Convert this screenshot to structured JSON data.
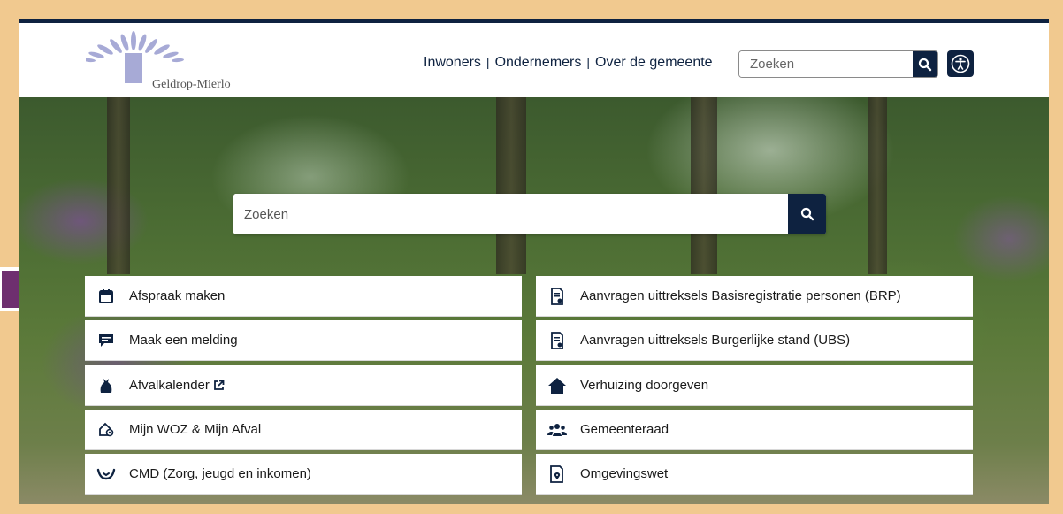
{
  "header": {
    "logo_text": "Geldrop-Mierlo",
    "nav": [
      "Inwoners",
      "Ondernemers",
      "Over de gemeente"
    ],
    "search_placeholder": "Zoeken"
  },
  "hero": {
    "search_placeholder": "Zoeken"
  },
  "tiles_left": [
    {
      "label": "Afspraak maken",
      "icon": "calendar-icon"
    },
    {
      "label": "Maak een melding",
      "icon": "chat-icon"
    },
    {
      "label": "Afvalkalender",
      "icon": "trash-bag-icon"
    },
    {
      "label": "Mijn WOZ & Mijn Afval",
      "icon": "house-pin-icon"
    },
    {
      "label": "CMD (Zorg, jeugd en inkomen)",
      "icon": "care-hands-icon"
    }
  ],
  "tiles_right": [
    {
      "label": "Aanvragen uittreksels Basisregistratie personen (BRP)",
      "icon": "document-icon"
    },
    {
      "label": "Aanvragen uittreksels Burgerlijke stand (UBS)",
      "icon": "document-icon"
    },
    {
      "label": "Verhuizing doorgeven",
      "icon": "home-icon"
    },
    {
      "label": "Gemeenteraad",
      "icon": "group-icon"
    },
    {
      "label": "Omgevingswet",
      "icon": "document-pin-icon"
    }
  ],
  "colors": {
    "navy": "#0e2240",
    "frame": "#f1c98f",
    "arrow": "#6e2f6f"
  }
}
